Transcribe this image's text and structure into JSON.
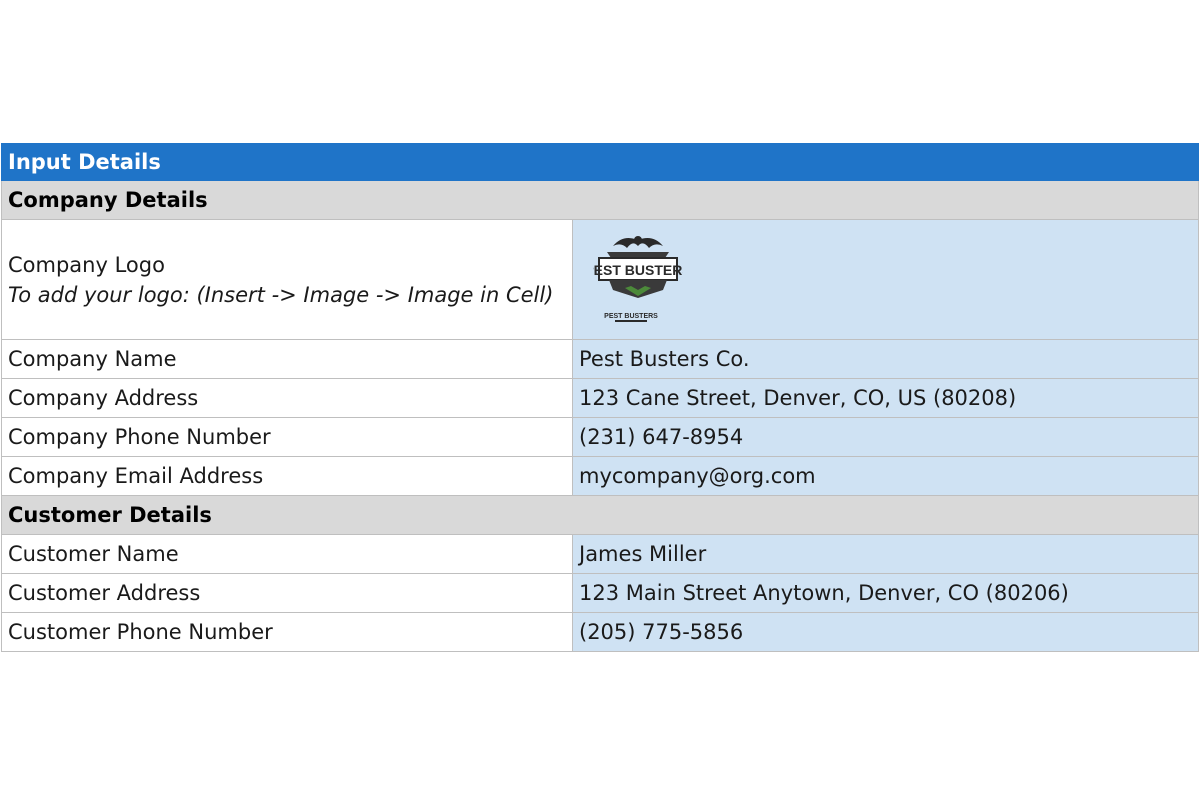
{
  "title": "Input Details",
  "company": {
    "header": "Company Details",
    "logo_label": "Company Logo",
    "logo_hint": "To add your logo: (Insert -> Image -> Image in Cell)",
    "logo_icon": "pest-busters-logo",
    "logo_text_main": "PEST BUSTERS",
    "logo_text_sub": "PEST BUSTERS",
    "rows": [
      {
        "label": "Company Name",
        "value": "Pest Busters Co."
      },
      {
        "label": "Company Address",
        "value": "123 Cane Street, Denver, CO, US (80208)"
      },
      {
        "label": "Company Phone Number",
        "value": "(231) 647-8954"
      },
      {
        "label": "Company Email Address",
        "value": "mycompany@org.com"
      }
    ]
  },
  "customer": {
    "header": "Customer Details",
    "rows": [
      {
        "label": "Customer Name",
        "value": "James Miller"
      },
      {
        "label": "Customer Address",
        "value": "123 Main Street Anytown, Denver, CO (80206)"
      },
      {
        "label": "Customer Phone Number",
        "value": "(205) 775-5856"
      }
    ]
  },
  "colors": {
    "title_bg": "#1f74c8",
    "section_bg": "#d9d9d9",
    "input_bg": "#cfe2f3"
  }
}
